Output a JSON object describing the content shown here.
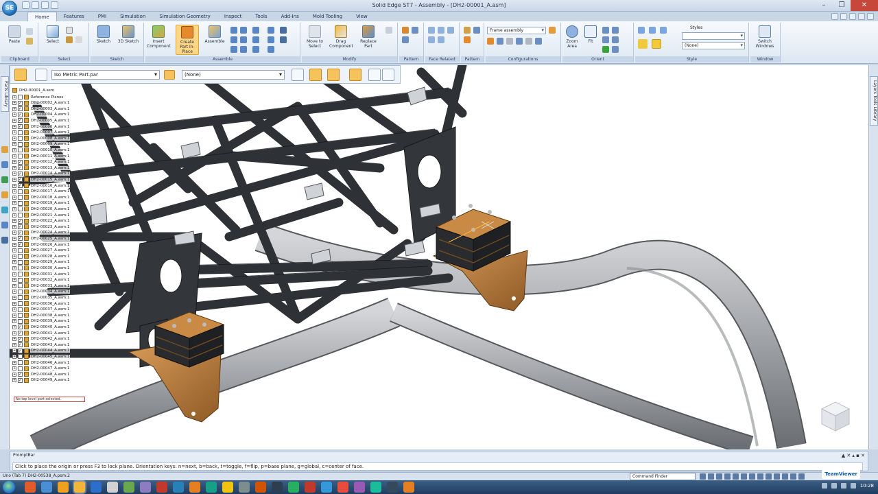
{
  "window": {
    "title": "Solid Edge ST7 - Assembly - [DH2-00001_A.asm]",
    "minimize": "–",
    "restore": "❐",
    "close": "✕"
  },
  "tabs": [
    "Home",
    "Features",
    "PMI",
    "Simulation",
    "Simulation Geometry",
    "Inspect",
    "Tools",
    "Add-Ins",
    "Mold Tooling",
    "View"
  ],
  "ribbon": {
    "groups": {
      "clipboard": "Clipboard",
      "select": "Select",
      "sketch": "Sketch",
      "assemble": "Assemble",
      "modify": "Modify",
      "pattern": "Pattern",
      "face_related": "Face Related",
      "configurations": "Configurations",
      "orient": "Orient",
      "style": "Style",
      "window": "Window"
    },
    "buttons": {
      "paste": "Paste",
      "select": "Select",
      "sketch": "Sketch",
      "sketch3d": "3D Sketch",
      "insert_component": "Insert Component",
      "create_part": "Create Part In-Place",
      "assemble": "Assemble",
      "move_select": "Move to Select",
      "drag_component": "Drag Component",
      "replace_part": "Replace Part",
      "zoom_area": "Zoom Area",
      "fit": "Fit",
      "switch_windows": "Switch Windows"
    },
    "configurations_combo": "Frame assembly",
    "style_label": "Styles",
    "style_combo": "(None)"
  },
  "pathfinder_bar": {
    "part_template": "Iso Metric Part.par",
    "layer_combo": "(None)"
  },
  "left_tabs": [
    "Parts Library"
  ],
  "right_tabs": [
    "Layers Tools Library"
  ],
  "tree": {
    "root": "DH2-00001_A.asm",
    "rows": [
      {
        "label": "Reference Planes",
        "checked": false
      },
      {
        "label": "DH2-00002_A.asm:1",
        "checked": true
      },
      {
        "label": "DH2-00003_A.asm:1",
        "checked": true
      },
      {
        "label": "DH2-00004_A.asm:1",
        "checked": true
      },
      {
        "label": "DH2-00005_A.asm:1",
        "checked": true
      },
      {
        "label": "DH2-00006_A.asm:1",
        "checked": true
      },
      {
        "label": "DH2-00007_A.asm:1",
        "checked": false
      },
      {
        "label": "DH2-00008_A.asm:1",
        "checked": false
      },
      {
        "label": "DH2-00009_A.asm:1",
        "checked": false
      },
      {
        "label": "DH2-00010_A.asm:1",
        "checked": false
      },
      {
        "label": "DH2-00011_A.asm:1",
        "checked": false
      },
      {
        "label": "DH2-00012_A.asm:1",
        "checked": true
      },
      {
        "label": "DH2-00013_A.asm:1",
        "checked": true
      },
      {
        "label": "DH2-00014_A.asm:1",
        "checked": true
      },
      {
        "label": "DH2-00015_A.asm:1",
        "checked": true
      },
      {
        "label": "DH2-00016_A.asm:1",
        "checked": true
      },
      {
        "label": "DH2-00017_A.asm:1",
        "checked": false
      },
      {
        "label": "DH2-00018_A.asm:1",
        "checked": false
      },
      {
        "label": "DH2-00019_A.asm:1",
        "checked": false
      },
      {
        "label": "DH2-00020_A.asm:1",
        "checked": false
      },
      {
        "label": "DH2-00021_A.asm:1",
        "checked": false
      },
      {
        "label": "DH2-00022_A.asm:1",
        "checked": true
      },
      {
        "label": "DH2-00023_A.asm:1",
        "checked": true
      },
      {
        "label": "DH2-00024_A.asm:1",
        "checked": true
      },
      {
        "label": "DH2-00025_A.asm:1",
        "checked": true
      },
      {
        "label": "DH2-00026_A.asm:1",
        "checked": true
      },
      {
        "label": "DH2-00027_A.asm:1",
        "checked": false
      },
      {
        "label": "DH2-00028_A.asm:1",
        "checked": false
      },
      {
        "label": "DH2-00029_A.asm:1",
        "checked": false
      },
      {
        "label": "DH2-00030_A.asm:1",
        "checked": false
      },
      {
        "label": "DH2-00031_A.asm:1",
        "checked": false
      },
      {
        "label": "DH2-00032_A.asm:1",
        "checked": false
      },
      {
        "label": "DH2-00033_A.asm:1",
        "checked": false
      },
      {
        "label": "DH2-00034_A.asm:1",
        "checked": false
      },
      {
        "label": "DH2-00035_A.asm:1",
        "checked": false
      },
      {
        "label": "DH2-00036_A.asm:1",
        "checked": false
      },
      {
        "label": "DH2-00037_A.asm:1",
        "checked": false
      },
      {
        "label": "DH2-00038_A.asm:1",
        "checked": false
      },
      {
        "label": "DH2-00039_A.asm:1",
        "checked": false
      },
      {
        "label": "DH2-00040_A.asm:1",
        "checked": true
      },
      {
        "label": "DH2-00041_A.asm:1",
        "checked": true
      },
      {
        "label": "DH2-00042_A.asm:1",
        "checked": true
      },
      {
        "label": "DH2-00043_A.asm:1",
        "checked": true
      },
      {
        "label": "DH2-00044_A.asm:1",
        "checked": true
      },
      {
        "label": "DH2-00045_A.asm:1",
        "checked": false
      },
      {
        "label": "DH2-00046_A.asm:1",
        "checked": false
      },
      {
        "label": "DH2-00047_A.asm:1",
        "checked": false
      },
      {
        "label": "DH2-00048_A.asm:1",
        "checked": true
      },
      {
        "label": "DH2-00049_A.asm:1",
        "checked": true
      }
    ],
    "status": "No top level part selected."
  },
  "promptbar": {
    "title": "PromptBar",
    "text": "Click to place the origin or press F3 to lock plane. Orientation keys: n=next, b=back, t=toggle, f=flip, p=base plane, g=global, c=center of face.",
    "controls": "▲ ✕ ▴ ▪ ✕"
  },
  "statusbar": {
    "text": "Uno (Tab 7) DH2-00538_A.psm:2",
    "command_finder": "Command Finder",
    "teamviewer": "TeamViewer"
  },
  "taskbar": {
    "clock": "10:28"
  },
  "colors": {
    "frame": "#2e3136",
    "frame_edge": "#16181b",
    "tube": "#a4a7ab",
    "bracket": "#b87a3c",
    "accent": "#f6c25b"
  }
}
